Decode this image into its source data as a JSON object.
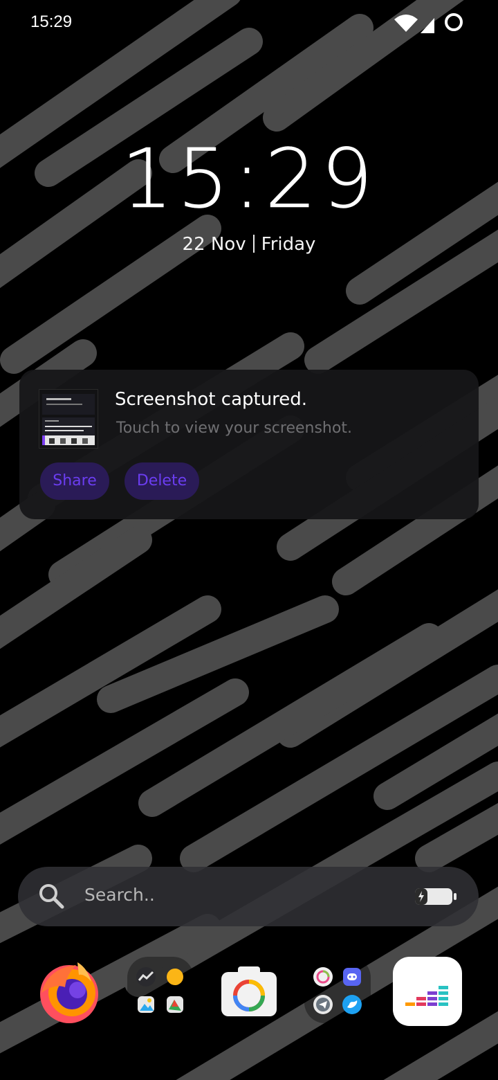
{
  "status_bar": {
    "time": "15:29",
    "icons": [
      "wifi-icon",
      "signal-icon",
      "loading-ring-icon"
    ]
  },
  "lockclock": {
    "time": "15:29",
    "date": "22 Nov",
    "day": "Friday"
  },
  "notification": {
    "title": "Screenshot captured.",
    "body": "Touch to view your screenshot.",
    "actions": {
      "share": "Share",
      "delete": "Delete"
    },
    "accent": "#6b3df0"
  },
  "search": {
    "placeholder": "Search.."
  },
  "dock": {
    "apps": [
      "firefox-icon",
      "app-folder-1",
      "camera-icon",
      "app-folder-2",
      "deezer-icon"
    ]
  },
  "colors": {
    "stripe": "#4a4a4a",
    "background": "#000000"
  }
}
